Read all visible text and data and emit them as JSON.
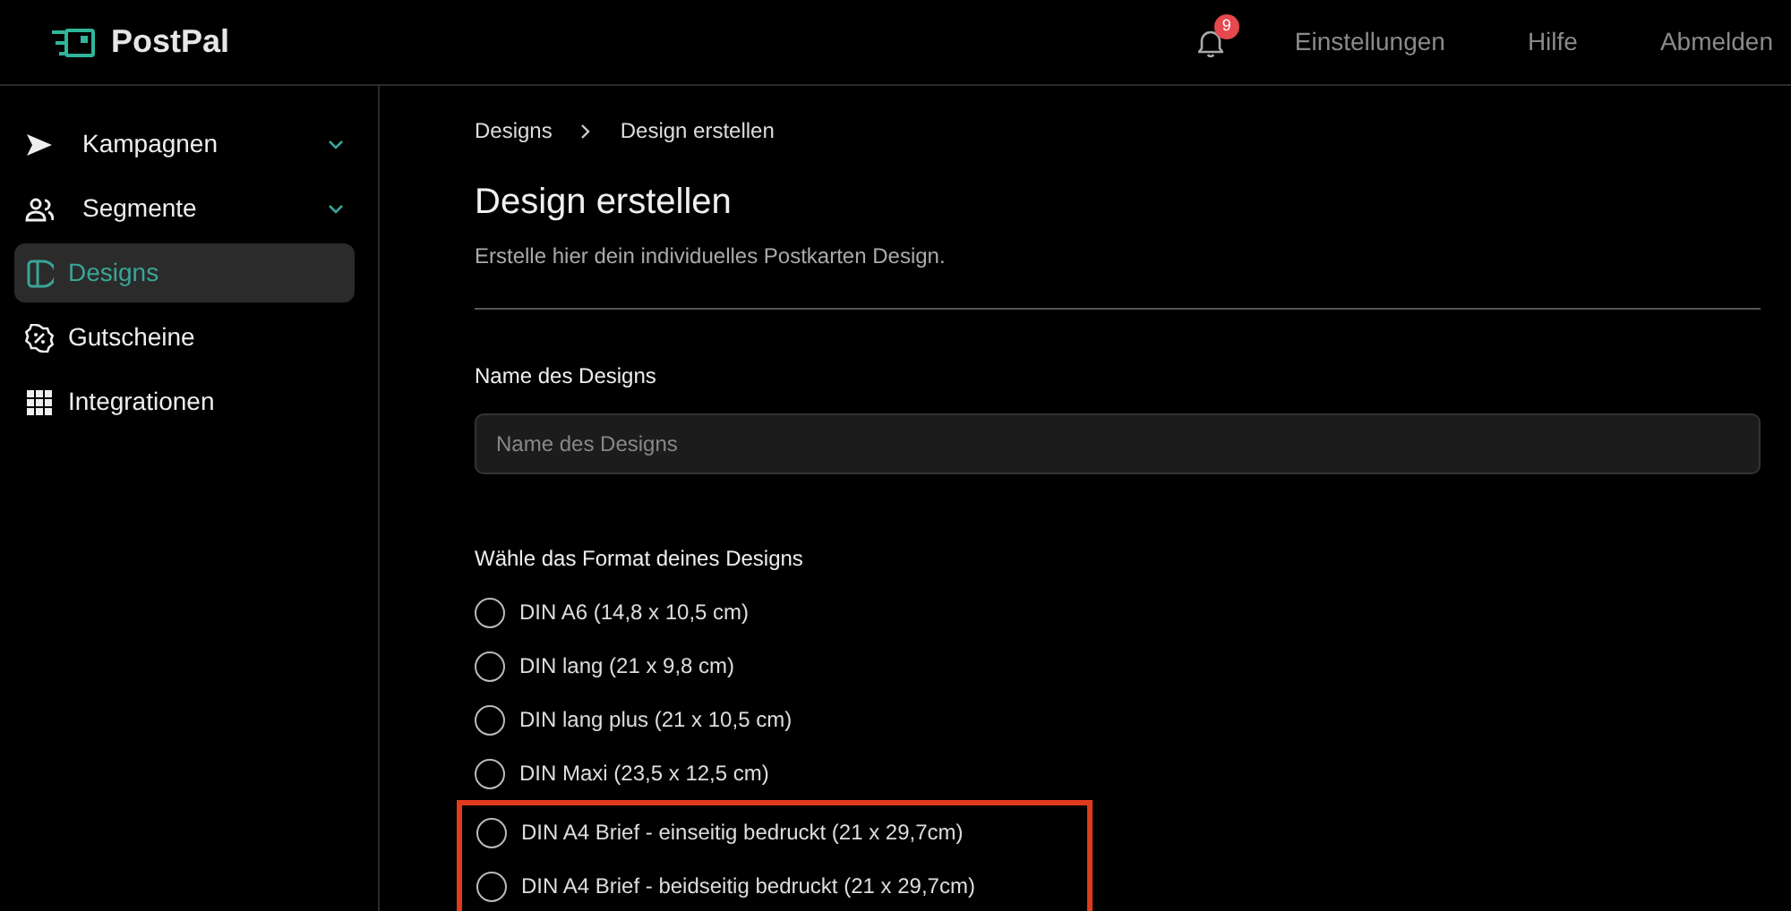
{
  "app": {
    "name": "PostPal"
  },
  "header": {
    "notifications": "9",
    "links": [
      "Einstellungen",
      "Hilfe",
      "Abmelden"
    ]
  },
  "sidebar": {
    "items": [
      {
        "label": "Kampagnen",
        "kind": "send",
        "has_submenu": true,
        "selected": false
      },
      {
        "label": "Segmente",
        "kind": "people",
        "has_submenu": true,
        "selected": false
      },
      {
        "label": "Designs",
        "kind": "card",
        "has_submenu": false,
        "selected": true
      },
      {
        "label": "Gutscheine",
        "kind": "percent",
        "has_submenu": false,
        "selected": false
      },
      {
        "label": "Integrationen",
        "kind": "grid",
        "has_submenu": false,
        "selected": false
      }
    ]
  },
  "breadcrumb": [
    "Designs",
    "Design erstellen"
  ],
  "page": {
    "title": "Design erstellen",
    "subtitle": "Erstelle hier dein individuelles Postkarten Design."
  },
  "name_field": {
    "label": "Name des Designs",
    "placeholder": "Name des Designs"
  },
  "format": {
    "label": "Wähle das Format deines Designs",
    "options": [
      {
        "label": "DIN A6 (14,8 x 10,5 cm)",
        "selected": false,
        "highlighted": false
      },
      {
        "label": "DIN lang (21 x 9,8 cm)",
        "selected": false,
        "highlighted": false
      },
      {
        "label": "DIN lang plus (21 x 10,5 cm)",
        "selected": false,
        "highlighted": false
      },
      {
        "label": "DIN Maxi (23,5 x 12,5 cm)",
        "selected": false,
        "highlighted": false
      },
      {
        "label": "DIN A4 Brief - einseitig bedruckt (21 x 29,7cm)",
        "selected": false,
        "highlighted": true
      },
      {
        "label": "DIN A4 Brief - beidseitig bedruckt (21 x 29,7cm)",
        "selected": false,
        "highlighted": true
      }
    ]
  }
}
